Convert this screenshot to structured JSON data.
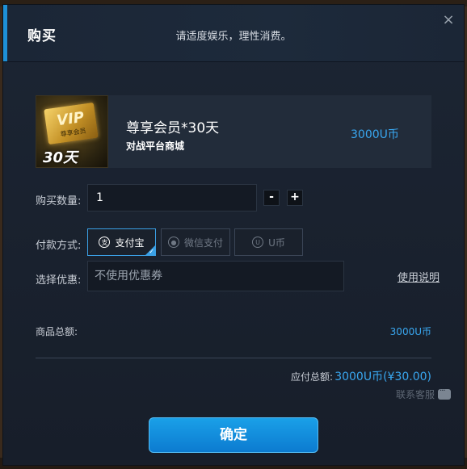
{
  "dialog": {
    "title": "购买",
    "subtitle": "请适度娱乐，理性消费。",
    "close_symbol": "×"
  },
  "product": {
    "image": {
      "badge_text": "VIP",
      "badge_subtext": "尊享会员",
      "days_text": "30天"
    },
    "name": "尊享会员*30天",
    "store": "对战平台商城",
    "price": "3000U币"
  },
  "form": {
    "quantity_label": "购买数量:",
    "quantity_value": "1",
    "minus_label": "-",
    "plus_label": "+",
    "payment_label": "付款方式:",
    "payment_options": [
      {
        "label": "支付宝",
        "icon": "alipay-icon",
        "selected": true
      },
      {
        "label": "微信支付",
        "icon": "wechat-icon",
        "selected": false
      },
      {
        "label": "U币",
        "icon": "ucoin-icon",
        "selected": false
      }
    ],
    "coupon_label": "选择优惠:",
    "coupon_placeholder": "不使用优惠券",
    "usage_link": "使用说明"
  },
  "summary": {
    "total_label": "商品总额:",
    "total_value": "3000U币",
    "payable_label": "应付总额:",
    "payable_value": "3000U币(¥30.00)",
    "service_label": "联系客服"
  },
  "confirm_label": "确定",
  "colors": {
    "accent": "#39a7f0",
    "button": "#1aa0e8",
    "header_accent": "#1e90d6"
  }
}
